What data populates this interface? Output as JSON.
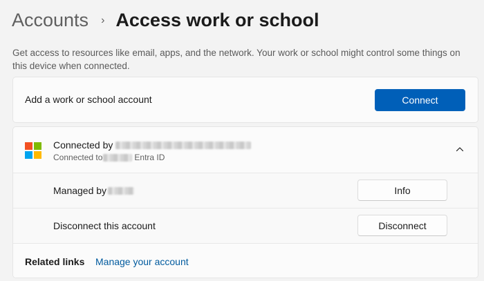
{
  "header": {
    "parent": "Accounts",
    "separator": "›",
    "title": "Access work or school"
  },
  "description": "Get access to resources like email, apps, and the network. Your work or school might control some things on this device when connected.",
  "add_account": {
    "label": "Add a work or school account",
    "button": "Connect"
  },
  "account": {
    "title_prefix": "Connected by",
    "subtitle_prefix": "Connected to",
    "subtitle_suffix": "Entra ID",
    "icon": "microsoft-logo",
    "expand_icon": "chevron-up-icon",
    "managed_label": "Managed by",
    "info_button": "Info",
    "disconnect_label": "Disconnect this account",
    "disconnect_button": "Disconnect"
  },
  "related": {
    "title": "Related links",
    "link": "Manage your account"
  },
  "colors": {
    "accent": "#005fb8",
    "link": "#005a9e",
    "background": "#f3f3f3"
  }
}
